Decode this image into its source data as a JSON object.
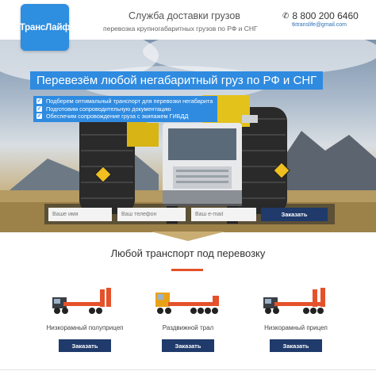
{
  "header": {
    "logo_text": "ТрансЛайф",
    "title": "Служба доставки грузов",
    "subtitle": "перевозка крупногабаритных грузов по РФ и СНГ",
    "phone": "8 800 200 6460",
    "email": "tktranslife@gmail.com"
  },
  "hero": {
    "headline": "Перевезём любой негабаритный груз по РФ и СНГ",
    "bullets": [
      "Подберем оптимальный транспорт для перевозки негабарита",
      "Подготовим сопроводительную документацию",
      "Обеспечим сопровождение груза с экипажем ГИБДД"
    ],
    "form": {
      "name_placeholder": "Ваше имя",
      "phone_placeholder": "Ваш телефон",
      "email_placeholder": "Ваш e-mail",
      "submit_label": "Заказать"
    }
  },
  "transport": {
    "title": "Любой транспорт под перевозку",
    "accent_color": "#e5512a",
    "items": [
      {
        "name": "Низкорамный полуприцеп",
        "button": "Заказать"
      },
      {
        "name": "Раздвижной трал",
        "button": "Заказать"
      },
      {
        "name": "Низкорамный прицеп",
        "button": "Заказать"
      }
    ]
  },
  "colors": {
    "brand_blue": "#2e8ee0",
    "button_navy": "#1f3a6b"
  }
}
